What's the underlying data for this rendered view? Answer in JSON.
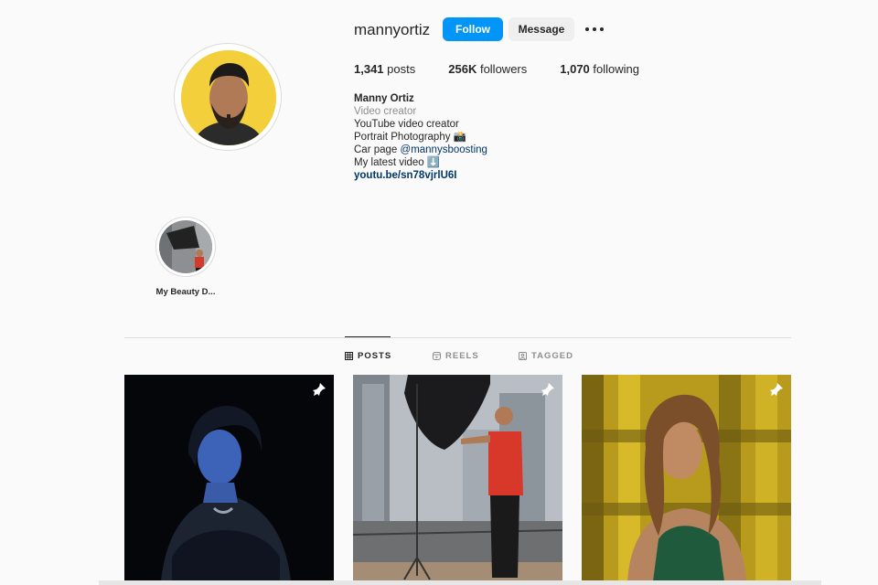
{
  "profile": {
    "username": "mannyortiz",
    "follow_label": "Follow",
    "message_label": "Message",
    "stats": [
      {
        "count": "1,341",
        "label": "posts"
      },
      {
        "count": "256K",
        "label": "followers"
      },
      {
        "count": "1,070",
        "label": "following"
      }
    ],
    "bio": {
      "name": "Manny Ortiz",
      "category": "Video creator",
      "line1": "YouTube video creator",
      "line2": "Portrait Photography 📸",
      "line3_prefix": "Car page ",
      "line3_mention": "@mannysboosting",
      "line4": "My latest video ⬇️",
      "link": "youtu.be/sn78vjrlU6I"
    }
  },
  "highlights": [
    {
      "label": "My Beauty D..."
    }
  ],
  "tabs": [
    {
      "label": "POSTS",
      "icon": "grid-icon",
      "active": true
    },
    {
      "label": "REELS",
      "icon": "reels-icon",
      "active": false
    },
    {
      "label": "TAGGED",
      "icon": "tagged-icon",
      "active": false
    }
  ],
  "posts": [
    {
      "subject": "blue-lit portrait",
      "pinned": true
    },
    {
      "subject": "photographer with softbox",
      "pinned": true
    },
    {
      "subject": "portrait with yellow background",
      "pinned": true
    }
  ],
  "colors": {
    "accent": "#0095f6",
    "link": "#00376b",
    "muted": "#8e8e8e"
  }
}
